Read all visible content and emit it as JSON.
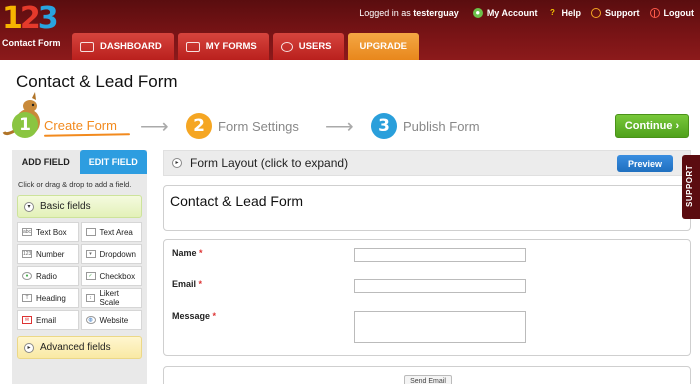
{
  "header": {
    "logo_number": "123",
    "logo_text": "Contact Form",
    "logged_in_prefix": "Logged in as",
    "username": "testerguay",
    "links": [
      {
        "label": "My Account",
        "icon": "user-icon"
      },
      {
        "label": "Help",
        "icon": "help-icon"
      },
      {
        "label": "Support",
        "icon": "headset-icon"
      },
      {
        "label": "Logout",
        "icon": "power-icon"
      }
    ],
    "nav": [
      {
        "label": "DASHBOARD",
        "icon": "dashboard-icon"
      },
      {
        "label": "MY FORMS",
        "icon": "forms-icon"
      },
      {
        "label": "USERS",
        "icon": "users-icon"
      },
      {
        "label": "UPGRADE"
      }
    ]
  },
  "page_title": "Contact & Lead Form",
  "steps": [
    {
      "number": "1",
      "label": "Create Form",
      "active": true
    },
    {
      "number": "2",
      "label": "Form Settings"
    },
    {
      "number": "3",
      "label": "Publish Form"
    }
  ],
  "continue_label": "Continue ›",
  "left_panel": {
    "tabs": [
      "ADD FIELD",
      "EDIT FIELD"
    ],
    "hint": "Click or drag & drop to add a field.",
    "basic_label": "Basic fields",
    "fields": [
      {
        "label": "Text Box",
        "icon": "abc"
      },
      {
        "label": "Text Area",
        "icon": ""
      },
      {
        "label": "Number",
        "icon": "123"
      },
      {
        "label": "Dropdown",
        "icon": "▾"
      },
      {
        "label": "Radio",
        "icon": "●"
      },
      {
        "label": "Checkbox",
        "icon": "✓"
      },
      {
        "label": "Heading",
        "icon": "T"
      },
      {
        "label": "Likert Scale",
        "icon": "↕"
      },
      {
        "label": "Email",
        "icon": "✉"
      },
      {
        "label": "Website",
        "icon": "◍"
      }
    ],
    "advanced_label": "Advanced fields"
  },
  "main": {
    "layout_label": "Form Layout (click to expand)",
    "preview_label": "Preview",
    "form_title": "Contact & Lead Form",
    "form_fields": [
      {
        "label": "Name",
        "required": "*"
      },
      {
        "label": "Email",
        "required": "*"
      },
      {
        "label": "Message",
        "required": "*"
      }
    ],
    "send_label": "Send Email"
  },
  "support_label": "SUPPORT",
  "colors": {
    "header": "#7a1416",
    "nav_tab": "#c9302c",
    "upgrade": "#f0952c",
    "continue": "#5fb22a",
    "edit_tab": "#2d9de0",
    "step_active": "#f28a1e"
  }
}
